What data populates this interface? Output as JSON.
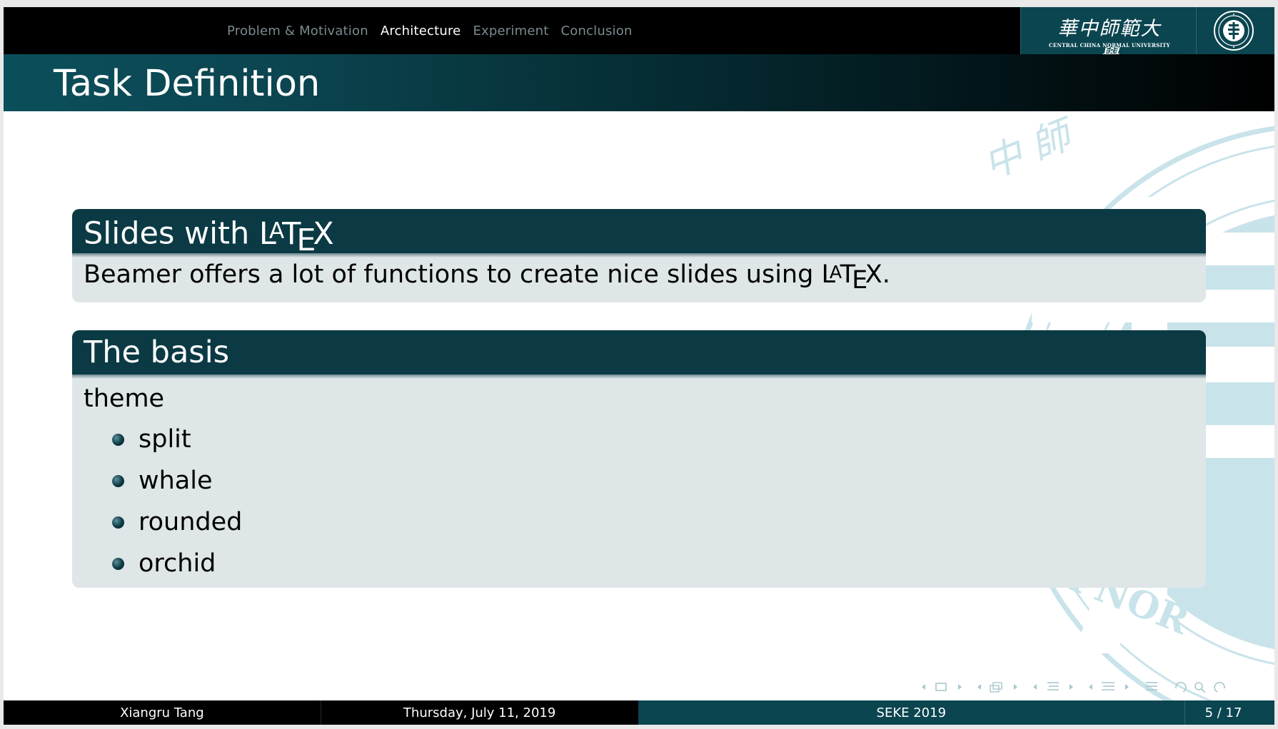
{
  "navigation": {
    "sections": [
      {
        "label": "Problem & Motivation",
        "active": false
      },
      {
        "label": "Architecture",
        "active": true
      },
      {
        "label": "Experiment",
        "active": false
      },
      {
        "label": "Conclusion",
        "active": false
      }
    ]
  },
  "logo": {
    "name_cn": "華中師範大學",
    "name_en": "CENTRAL CHINA NORMAL UNIVERSITY",
    "emblem_icon": "university-seal-icon"
  },
  "frame": {
    "title": "Task Definition"
  },
  "blocks": {
    "first": {
      "title_text": "Slides with",
      "title_logo": "LaTeX",
      "body_text": "Beamer offers a lot of functions to create nice slides using",
      "body_logo": "LaTeX",
      "body_end": "."
    },
    "second": {
      "title": "The basis",
      "label": "theme",
      "items": [
        "split",
        "whale",
        "rounded",
        "orchid"
      ]
    }
  },
  "watermark": {
    "chars": "中 師",
    "arc_text": "CHINA NOR"
  },
  "footer": {
    "author": "Xiangru Tang",
    "date": "Thursday, July 11, 2019",
    "conference": "SEKE 2019",
    "page": "5 / 17"
  },
  "colors": {
    "dark_teal": "#0b3a44",
    "brand_teal": "#0b4550",
    "block_bg": "#dfe6e8",
    "watermark": "#c9e3ea"
  }
}
